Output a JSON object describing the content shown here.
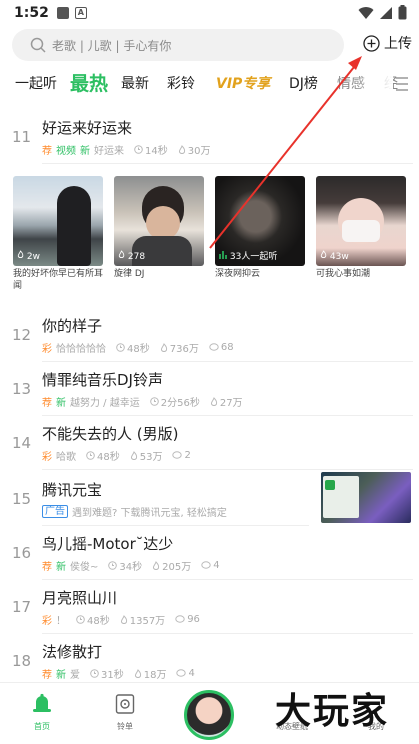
{
  "status": {
    "time": "1:52",
    "a_icon": "A"
  },
  "search": {
    "placeholder": "老歌 | 儿歌 | 手心有你",
    "upload_label": "上传"
  },
  "tabs": [
    {
      "label": "一起听"
    },
    {
      "label": "最热"
    },
    {
      "label": "最新"
    },
    {
      "label": "彩铃"
    },
    {
      "label": "VIP专享"
    },
    {
      "label": "DJ榜"
    },
    {
      "label": "情感"
    },
    {
      "label": "经"
    }
  ],
  "top_song": {
    "rank": "11",
    "title": "好运来好运来",
    "tag1": "荐",
    "tag2": "视频",
    "tag3": "新",
    "artist": "好运来",
    "duration": "14秒",
    "plays": "30万"
  },
  "videos": [
    {
      "count": "2w",
      "caption": "我的好坏你早已有所耳闻"
    },
    {
      "count": "278",
      "caption": "旋律 DJ"
    },
    {
      "count": "33人一起听",
      "caption": "深夜网抑云"
    },
    {
      "count": "43w",
      "caption": "可我心事如潮"
    }
  ],
  "songs": [
    {
      "rank": "12",
      "title": "你的样子",
      "tag1": "彩",
      "tag2": "",
      "artist": "恰恰恰恰恰",
      "duration": "48秒",
      "plays": "736万",
      "comments": "68"
    },
    {
      "rank": "13",
      "title": "情罪纯音乐DJ铃声",
      "tag1": "荐",
      "tag2": "新",
      "artist": "越努力 / 越幸运",
      "duration": "2分56秒",
      "plays": "27万",
      "comments": ""
    },
    {
      "rank": "14",
      "title": "不能失去的人 (男版)",
      "tag1": "彩",
      "tag2": "",
      "artist": "哈歌",
      "duration": "48秒",
      "plays": "53万",
      "comments": "2"
    },
    {
      "rank": "15",
      "title": "腾讯元宝",
      "tag1": "广告",
      "tag2": "",
      "artist": "遇到难题? 下载腾讯元宝, 轻松搞定",
      "duration": "",
      "plays": "",
      "comments": ""
    },
    {
      "rank": "16",
      "title": "鸟儿摇-Motor˘达少",
      "tag1": "荐",
      "tag2": "新",
      "artist": "侯俊~",
      "duration": "34秒",
      "plays": "205万",
      "comments": "4"
    },
    {
      "rank": "17",
      "title": "月亮照山川",
      "tag1": "彩",
      "tag2": "",
      "artist": "！",
      "duration": "48秒",
      "plays": "1357万",
      "comments": "96"
    },
    {
      "rank": "18",
      "title": "法修散打",
      "tag1": "荐",
      "tag2": "新",
      "artist": "爱",
      "duration": "31秒",
      "plays": "18万",
      "comments": "4"
    }
  ],
  "bottom_nav": {
    "home": "首页",
    "playlist": "铃单",
    "feed": "动态壁纸",
    "mine": "我的"
  },
  "watermark": "大玩家",
  "colors": {
    "accent": "#2cbf62",
    "vip": "#e2a21d",
    "rec": "#ff8a2b",
    "arrow": "#e8322b"
  }
}
